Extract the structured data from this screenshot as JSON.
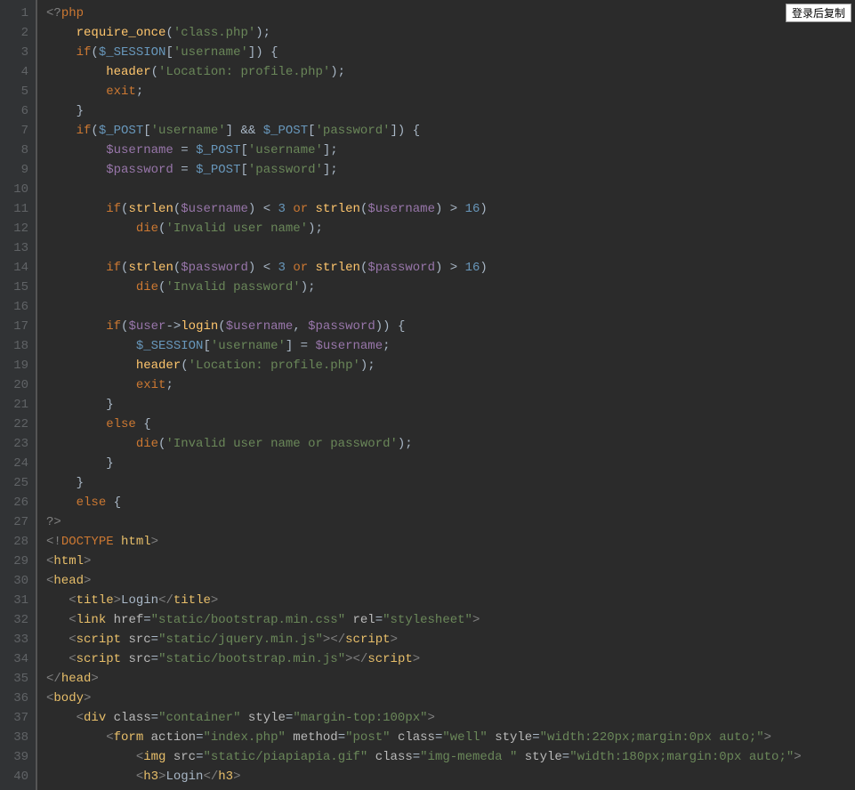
{
  "copy_button_label": "登录后复制",
  "line_count": 40,
  "code_lines": [
    [
      [
        "t-pl",
        "<?"
      ],
      [
        "t-kw",
        "php"
      ]
    ],
    [
      [
        "t-d",
        "    "
      ],
      [
        "t-fn",
        "require_once"
      ],
      [
        "t-d",
        "("
      ],
      [
        "t-str",
        "'class.php'"
      ],
      [
        "t-d",
        ");"
      ]
    ],
    [
      [
        "t-d",
        "    "
      ],
      [
        "t-kw",
        "if"
      ],
      [
        "t-d",
        "("
      ],
      [
        "t-sess",
        "$_SESSION"
      ],
      [
        "t-d",
        "["
      ],
      [
        "t-str",
        "'username'"
      ],
      [
        "t-d",
        "]) {"
      ]
    ],
    [
      [
        "t-d",
        "        "
      ],
      [
        "t-fn",
        "header"
      ],
      [
        "t-d",
        "("
      ],
      [
        "t-str",
        "'Location: profile.php'"
      ],
      [
        "t-d",
        ");"
      ]
    ],
    [
      [
        "t-d",
        "        "
      ],
      [
        "t-kw",
        "exit"
      ],
      [
        "t-d",
        ";"
      ]
    ],
    [
      [
        "t-d",
        "    }"
      ]
    ],
    [
      [
        "t-d",
        "    "
      ],
      [
        "t-kw",
        "if"
      ],
      [
        "t-d",
        "("
      ],
      [
        "t-sess",
        "$_POST"
      ],
      [
        "t-d",
        "["
      ],
      [
        "t-str",
        "'username'"
      ],
      [
        "t-d",
        "] && "
      ],
      [
        "t-sess",
        "$_POST"
      ],
      [
        "t-d",
        "["
      ],
      [
        "t-str",
        "'password'"
      ],
      [
        "t-d",
        "]) {"
      ]
    ],
    [
      [
        "t-d",
        "        "
      ],
      [
        "t-var",
        "$username"
      ],
      [
        "t-d",
        " = "
      ],
      [
        "t-sess",
        "$_POST"
      ],
      [
        "t-d",
        "["
      ],
      [
        "t-str",
        "'username'"
      ],
      [
        "t-d",
        "];"
      ]
    ],
    [
      [
        "t-d",
        "        "
      ],
      [
        "t-var",
        "$password"
      ],
      [
        "t-d",
        " = "
      ],
      [
        "t-sess",
        "$_POST"
      ],
      [
        "t-d",
        "["
      ],
      [
        "t-str",
        "'password'"
      ],
      [
        "t-d",
        "];"
      ]
    ],
    [
      [
        "t-d",
        ""
      ]
    ],
    [
      [
        "t-d",
        "        "
      ],
      [
        "t-kw",
        "if"
      ],
      [
        "t-d",
        "("
      ],
      [
        "t-fn",
        "strlen"
      ],
      [
        "t-d",
        "("
      ],
      [
        "t-var",
        "$username"
      ],
      [
        "t-d",
        ") < "
      ],
      [
        "t-num",
        "3"
      ],
      [
        "t-d",
        " "
      ],
      [
        "t-kw",
        "or"
      ],
      [
        "t-d",
        " "
      ],
      [
        "t-fn",
        "strlen"
      ],
      [
        "t-d",
        "("
      ],
      [
        "t-var",
        "$username"
      ],
      [
        "t-d",
        ") > "
      ],
      [
        "t-num",
        "16"
      ],
      [
        "t-d",
        ")"
      ]
    ],
    [
      [
        "t-d",
        "            "
      ],
      [
        "t-kw",
        "die"
      ],
      [
        "t-d",
        "("
      ],
      [
        "t-str",
        "'Invalid user name'"
      ],
      [
        "t-d",
        ");"
      ]
    ],
    [
      [
        "t-d",
        ""
      ]
    ],
    [
      [
        "t-d",
        "        "
      ],
      [
        "t-kw",
        "if"
      ],
      [
        "t-d",
        "("
      ],
      [
        "t-fn",
        "strlen"
      ],
      [
        "t-d",
        "("
      ],
      [
        "t-var",
        "$password"
      ],
      [
        "t-d",
        ") < "
      ],
      [
        "t-num",
        "3"
      ],
      [
        "t-d",
        " "
      ],
      [
        "t-kw",
        "or"
      ],
      [
        "t-d",
        " "
      ],
      [
        "t-fn",
        "strlen"
      ],
      [
        "t-d",
        "("
      ],
      [
        "t-var",
        "$password"
      ],
      [
        "t-d",
        ") > "
      ],
      [
        "t-num",
        "16"
      ],
      [
        "t-d",
        ")"
      ]
    ],
    [
      [
        "t-d",
        "            "
      ],
      [
        "t-kw",
        "die"
      ],
      [
        "t-d",
        "("
      ],
      [
        "t-str",
        "'Invalid password'"
      ],
      [
        "t-d",
        ");"
      ]
    ],
    [
      [
        "t-d",
        ""
      ]
    ],
    [
      [
        "t-d",
        "        "
      ],
      [
        "t-kw",
        "if"
      ],
      [
        "t-d",
        "("
      ],
      [
        "t-var",
        "$user"
      ],
      [
        "t-d",
        "->"
      ],
      [
        "t-fn",
        "login"
      ],
      [
        "t-d",
        "("
      ],
      [
        "t-var",
        "$username"
      ],
      [
        "t-d",
        ", "
      ],
      [
        "t-var",
        "$password"
      ],
      [
        "t-d",
        ")) {"
      ]
    ],
    [
      [
        "t-d",
        "            "
      ],
      [
        "t-sess",
        "$_SESSION"
      ],
      [
        "t-d",
        "["
      ],
      [
        "t-str",
        "'username'"
      ],
      [
        "t-d",
        "] = "
      ],
      [
        "t-var",
        "$username"
      ],
      [
        "t-d",
        ";"
      ]
    ],
    [
      [
        "t-d",
        "            "
      ],
      [
        "t-fn",
        "header"
      ],
      [
        "t-d",
        "("
      ],
      [
        "t-str",
        "'Location: profile.php'"
      ],
      [
        "t-d",
        ");"
      ]
    ],
    [
      [
        "t-d",
        "            "
      ],
      [
        "t-kw",
        "exit"
      ],
      [
        "t-d",
        ";"
      ]
    ],
    [
      [
        "t-d",
        "        }"
      ]
    ],
    [
      [
        "t-d",
        "        "
      ],
      [
        "t-kw",
        "else"
      ],
      [
        "t-d",
        " {"
      ]
    ],
    [
      [
        "t-d",
        "            "
      ],
      [
        "t-kw",
        "die"
      ],
      [
        "t-d",
        "("
      ],
      [
        "t-str",
        "'Invalid user name or password'"
      ],
      [
        "t-d",
        ");"
      ]
    ],
    [
      [
        "t-d",
        "        }"
      ]
    ],
    [
      [
        "t-d",
        "    }"
      ]
    ],
    [
      [
        "t-d",
        "    "
      ],
      [
        "t-kw",
        "else"
      ],
      [
        "t-d",
        " {"
      ]
    ],
    [
      [
        "t-pl",
        "?>"
      ]
    ],
    [
      [
        "t-pl",
        "<!"
      ],
      [
        "t-kw",
        "DOCTYPE "
      ],
      [
        "t-tag",
        "html"
      ],
      [
        "t-pl",
        ">"
      ]
    ],
    [
      [
        "t-pl",
        "<"
      ],
      [
        "t-tag",
        "html"
      ],
      [
        "t-pl",
        ">"
      ]
    ],
    [
      [
        "t-pl",
        "<"
      ],
      [
        "t-tag",
        "head"
      ],
      [
        "t-pl",
        ">"
      ]
    ],
    [
      [
        "t-d",
        "   "
      ],
      [
        "t-pl",
        "<"
      ],
      [
        "t-tag",
        "title"
      ],
      [
        "t-pl",
        ">"
      ],
      [
        "t-d",
        "Login"
      ],
      [
        "t-pl",
        "</"
      ],
      [
        "t-tag",
        "title"
      ],
      [
        "t-pl",
        ">"
      ]
    ],
    [
      [
        "t-d",
        "   "
      ],
      [
        "t-pl",
        "<"
      ],
      [
        "t-tag",
        "link"
      ],
      [
        "t-d",
        " "
      ],
      [
        "t-attr",
        "href"
      ],
      [
        "t-d",
        "="
      ],
      [
        "t-str",
        "\"static/bootstrap.min.css\""
      ],
      [
        "t-d",
        " "
      ],
      [
        "t-attr",
        "rel"
      ],
      [
        "t-d",
        "="
      ],
      [
        "t-str",
        "\"stylesheet\""
      ],
      [
        "t-pl",
        ">"
      ]
    ],
    [
      [
        "t-d",
        "   "
      ],
      [
        "t-pl",
        "<"
      ],
      [
        "t-tag",
        "script"
      ],
      [
        "t-d",
        " "
      ],
      [
        "t-attr",
        "src"
      ],
      [
        "t-d",
        "="
      ],
      [
        "t-str",
        "\"static/jquery.min.js\""
      ],
      [
        "t-pl",
        "></"
      ],
      [
        "t-tag",
        "script"
      ],
      [
        "t-pl",
        ">"
      ]
    ],
    [
      [
        "t-d",
        "   "
      ],
      [
        "t-pl",
        "<"
      ],
      [
        "t-tag",
        "script"
      ],
      [
        "t-d",
        " "
      ],
      [
        "t-attr",
        "src"
      ],
      [
        "t-d",
        "="
      ],
      [
        "t-str",
        "\"static/bootstrap.min.js\""
      ],
      [
        "t-pl",
        "></"
      ],
      [
        "t-tag",
        "script"
      ],
      [
        "t-pl",
        ">"
      ]
    ],
    [
      [
        "t-pl",
        "</"
      ],
      [
        "t-tag",
        "head"
      ],
      [
        "t-pl",
        ">"
      ]
    ],
    [
      [
        "t-pl",
        "<"
      ],
      [
        "t-tag",
        "body"
      ],
      [
        "t-pl",
        ">"
      ]
    ],
    [
      [
        "t-d",
        "    "
      ],
      [
        "t-pl",
        "<"
      ],
      [
        "t-tag",
        "div"
      ],
      [
        "t-d",
        " "
      ],
      [
        "t-attr",
        "class"
      ],
      [
        "t-d",
        "="
      ],
      [
        "t-str",
        "\"container\""
      ],
      [
        "t-d",
        " "
      ],
      [
        "t-attr",
        "style"
      ],
      [
        "t-d",
        "="
      ],
      [
        "t-str",
        "\"margin-top:100px\""
      ],
      [
        "t-pl",
        ">"
      ]
    ],
    [
      [
        "t-d",
        "        "
      ],
      [
        "t-pl",
        "<"
      ],
      [
        "t-tag",
        "form"
      ],
      [
        "t-d",
        " "
      ],
      [
        "t-attr",
        "action"
      ],
      [
        "t-d",
        "="
      ],
      [
        "t-str",
        "\"index.php\""
      ],
      [
        "t-d",
        " "
      ],
      [
        "t-attr",
        "method"
      ],
      [
        "t-d",
        "="
      ],
      [
        "t-str",
        "\"post\""
      ],
      [
        "t-d",
        " "
      ],
      [
        "t-attr",
        "class"
      ],
      [
        "t-d",
        "="
      ],
      [
        "t-str",
        "\"well\""
      ],
      [
        "t-d",
        " "
      ],
      [
        "t-attr",
        "style"
      ],
      [
        "t-d",
        "="
      ],
      [
        "t-str",
        "\"width:220px;margin:0px auto;\""
      ],
      [
        "t-pl",
        ">"
      ]
    ],
    [
      [
        "t-d",
        "            "
      ],
      [
        "t-pl",
        "<"
      ],
      [
        "t-tag",
        "img"
      ],
      [
        "t-d",
        " "
      ],
      [
        "t-attr",
        "src"
      ],
      [
        "t-d",
        "="
      ],
      [
        "t-str",
        "\"static/piapiapia.gif\""
      ],
      [
        "t-d",
        " "
      ],
      [
        "t-attr",
        "class"
      ],
      [
        "t-d",
        "="
      ],
      [
        "t-str",
        "\"img-memeda \""
      ],
      [
        "t-d",
        " "
      ],
      [
        "t-attr",
        "style"
      ],
      [
        "t-d",
        "="
      ],
      [
        "t-str",
        "\"width:180px;margin:0px auto;\""
      ],
      [
        "t-pl",
        ">"
      ]
    ],
    [
      [
        "t-d",
        "            "
      ],
      [
        "t-pl",
        "<"
      ],
      [
        "t-tag",
        "h3"
      ],
      [
        "t-pl",
        ">"
      ],
      [
        "t-d",
        "Login"
      ],
      [
        "t-pl",
        "</"
      ],
      [
        "t-tag",
        "h3"
      ],
      [
        "t-pl",
        ">"
      ]
    ]
  ]
}
